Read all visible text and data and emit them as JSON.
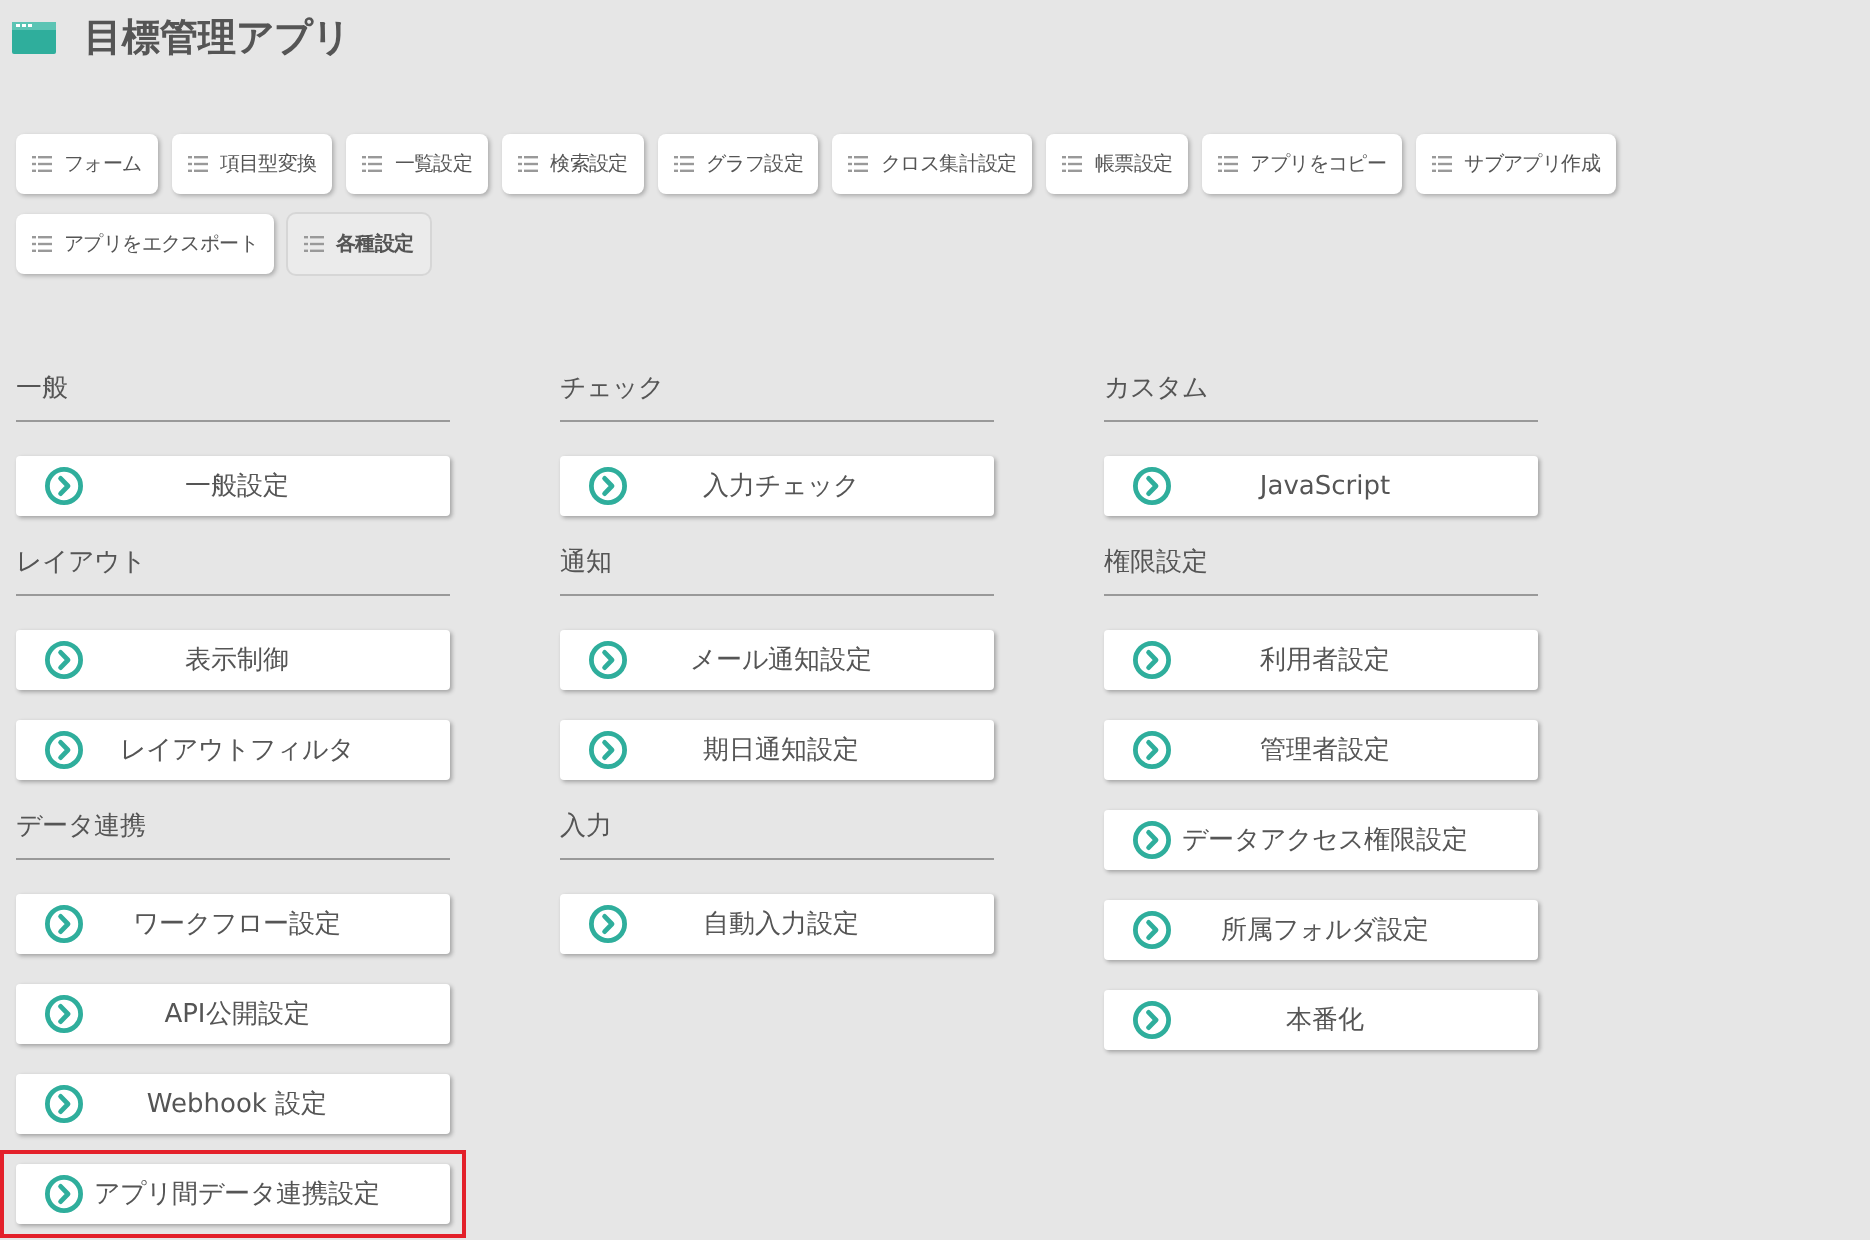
{
  "app_title": "目標管理アプリ",
  "toolbar": [
    {
      "label": "フォーム",
      "selected": false
    },
    {
      "label": "項目型変換",
      "selected": false
    },
    {
      "label": "一覧設定",
      "selected": false
    },
    {
      "label": "検索設定",
      "selected": false
    },
    {
      "label": "グラフ設定",
      "selected": false
    },
    {
      "label": "クロス集計設定",
      "selected": false
    },
    {
      "label": "帳票設定",
      "selected": false
    },
    {
      "label": "アプリをコピー",
      "selected": false
    },
    {
      "label": "サブアプリ作成",
      "selected": false
    },
    {
      "label": "アプリをエクスポート",
      "selected": false
    },
    {
      "label": "各種設定",
      "selected": true
    }
  ],
  "columns": [
    {
      "sections": [
        {
          "title": "一般",
          "items": [
            {
              "label": "一般設定",
              "highlighted": false
            }
          ]
        },
        {
          "title": "レイアウト",
          "items": [
            {
              "label": "表示制御",
              "highlighted": false
            },
            {
              "label": "レイアウトフィルタ",
              "highlighted": false
            }
          ]
        },
        {
          "title": "データ連携",
          "items": [
            {
              "label": "ワークフロー設定",
              "highlighted": false
            },
            {
              "label": "API公開設定",
              "highlighted": false
            },
            {
              "label": "Webhook 設定",
              "highlighted": false
            },
            {
              "label": "アプリ間データ連携設定",
              "highlighted": true
            }
          ]
        }
      ]
    },
    {
      "sections": [
        {
          "title": "チェック",
          "items": [
            {
              "label": "入力チェック",
              "highlighted": false
            }
          ]
        },
        {
          "title": "通知",
          "items": [
            {
              "label": "メール通知設定",
              "highlighted": false
            },
            {
              "label": "期日通知設定",
              "highlighted": false
            }
          ]
        },
        {
          "title": "入力",
          "items": [
            {
              "label": "自動入力設定",
              "highlighted": false
            }
          ]
        }
      ]
    },
    {
      "sections": [
        {
          "title": "カスタム",
          "items": [
            {
              "label": "JavaScript",
              "highlighted": false
            }
          ]
        },
        {
          "title": "権限設定",
          "items": [
            {
              "label": "利用者設定",
              "highlighted": false
            },
            {
              "label": "管理者設定",
              "highlighted": false
            },
            {
              "label": "データアクセス権限設定",
              "highlighted": false
            },
            {
              "label": "所属フォルダ設定",
              "highlighted": false
            },
            {
              "label": "本番化",
              "highlighted": false
            }
          ]
        }
      ]
    }
  ]
}
